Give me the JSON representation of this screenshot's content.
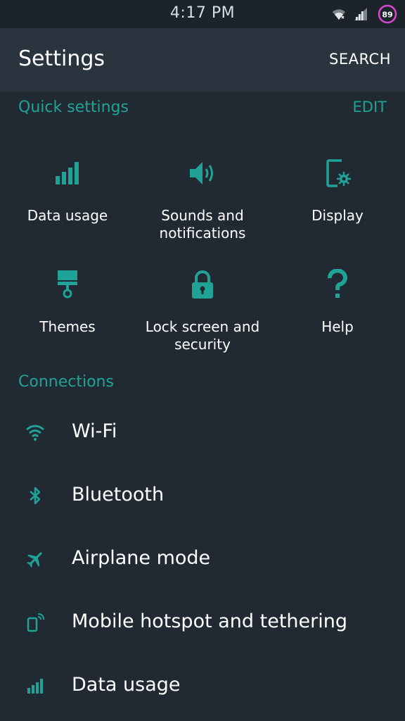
{
  "status_bar": {
    "time": "4:17 PM",
    "battery_level": "89",
    "icons": [
      "wifi-icon",
      "signal-icon",
      "battery-icon"
    ]
  },
  "app_bar": {
    "title": "Settings",
    "search_label": "SEARCH"
  },
  "quick_settings": {
    "header": "Quick settings",
    "edit_label": "EDIT",
    "tiles": [
      {
        "label": "Data usage",
        "icon": "data-usage-icon"
      },
      {
        "label": "Sounds and\nnotifications",
        "icon": "speaker-icon"
      },
      {
        "label": "Display",
        "icon": "display-icon"
      },
      {
        "label": "Themes",
        "icon": "paintbrush-icon"
      },
      {
        "label": "Lock screen and\nsecurity",
        "icon": "lock-icon"
      },
      {
        "label": "Help",
        "icon": "help-icon"
      }
    ]
  },
  "connections": {
    "header": "Connections",
    "items": [
      {
        "label": "Wi-Fi",
        "icon": "wifi-icon"
      },
      {
        "label": "Bluetooth",
        "icon": "bluetooth-icon"
      },
      {
        "label": "Airplane mode",
        "icon": "airplane-icon"
      },
      {
        "label": "Mobile hotspot and tethering",
        "icon": "hotspot-icon"
      },
      {
        "label": "Data usage",
        "icon": "data-usage-icon"
      }
    ]
  },
  "colors": {
    "background": "#212a33",
    "app_bar": "#2a343e",
    "status_bar": "#1c2329",
    "accent": "#1fa396",
    "battery_ring": "#d946d0"
  }
}
